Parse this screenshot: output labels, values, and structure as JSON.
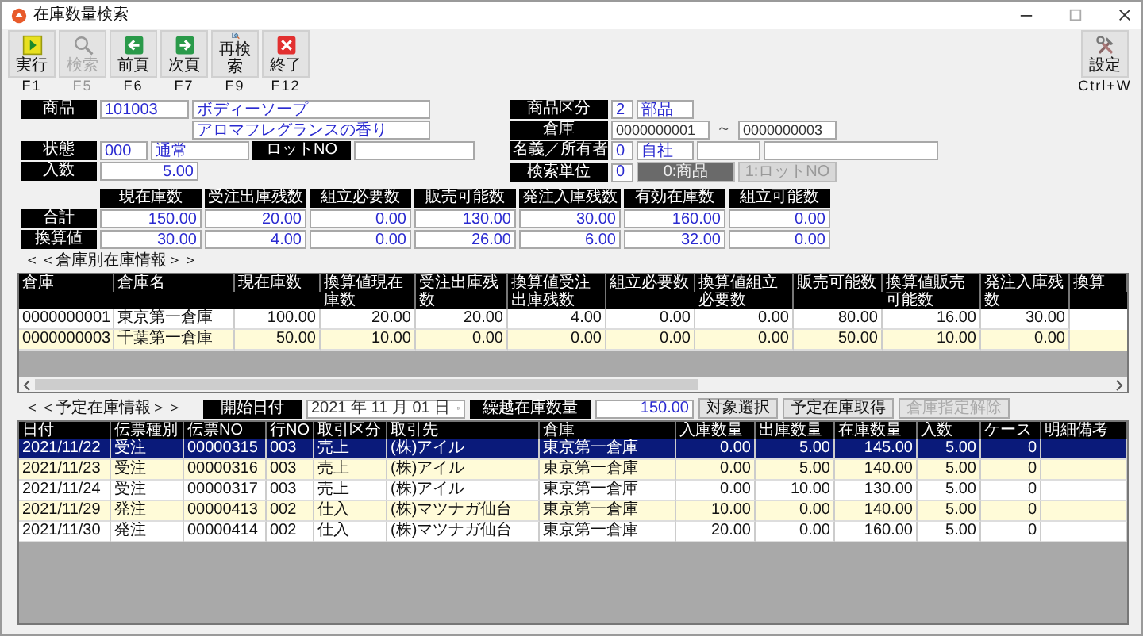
{
  "window": {
    "title": "在庫数量検索"
  },
  "toolbar": [
    {
      "kind": "run",
      "label": "実行",
      "key": "F1",
      "disabled": false
    },
    {
      "kind": "search",
      "label": "検索",
      "key": "F5",
      "disabled": true
    },
    {
      "kind": "prev",
      "label": "前頁",
      "key": "F6",
      "disabled": false
    },
    {
      "kind": "next",
      "label": "次頁",
      "key": "F7",
      "disabled": false
    },
    {
      "kind": "research",
      "label": "再検索",
      "key": "F9",
      "disabled": false
    },
    {
      "kind": "exit",
      "label": "終了",
      "key": "F12",
      "disabled": false
    }
  ],
  "settings": {
    "label": "設定",
    "key": "Ctrl+W"
  },
  "form": {
    "product": {
      "label": "商品",
      "code": "101003",
      "name": "ボディーソープ",
      "description": "アロマフレグランスの香り"
    },
    "status": {
      "label": "状態",
      "code": "000",
      "name": "通常"
    },
    "lot": {
      "label": "ロットNO"
    },
    "quantity": {
      "label": "入数",
      "value": "5.00"
    },
    "category": {
      "label": "商品区分",
      "code": "2",
      "name": "部品"
    },
    "warehouse": {
      "label": "倉庫",
      "from": "0000000001",
      "separator": "～",
      "to": "0000000003"
    },
    "owner": {
      "label": "名義／所有者",
      "code": "0",
      "name": "自社"
    },
    "search_unit": {
      "label": "検索単位",
      "code": "0",
      "options": [
        {
          "label": "0:商品",
          "selected": true
        },
        {
          "label": "1:ロットNO",
          "selected": false
        }
      ]
    }
  },
  "summary": {
    "columns": [
      "現在庫数",
      "受注出庫残数",
      "組立必要数",
      "販売可能数",
      "発注入庫残数",
      "有効在庫数",
      "組立可能数"
    ],
    "rows": [
      {
        "label": "合計",
        "values": [
          "150.00",
          "20.00",
          "0.00",
          "130.00",
          "30.00",
          "160.00",
          "0.00"
        ]
      },
      {
        "label": "換算値",
        "values": [
          "30.00",
          "4.00",
          "0.00",
          "26.00",
          "6.00",
          "32.00",
          "0.00"
        ]
      }
    ]
  },
  "warehouse_stock": {
    "title": "＜＜倉庫別在庫情報＞＞",
    "columns": [
      "倉庫",
      "倉庫名",
      "現在庫数",
      "換算値現在庫数",
      "受注出庫残数",
      "換算値受注出庫残数",
      "組立必要数",
      "換算値組立必要数",
      "販売可能数",
      "換算値販売可能数",
      "発注入庫残数",
      "換算"
    ],
    "rows": [
      {
        "cells": [
          "0000000001",
          "東京第一倉庫",
          "100.00",
          "20.00",
          "20.00",
          "4.00",
          "0.00",
          "0.00",
          "80.00",
          "16.00",
          "30.00"
        ]
      },
      {
        "cells": [
          "0000000003",
          "千葉第一倉庫",
          "50.00",
          "10.00",
          "0.00",
          "0.00",
          "0.00",
          "0.00",
          "50.00",
          "10.00",
          "0.00"
        ]
      }
    ]
  },
  "schedule": {
    "title": "＜＜予定在庫情報＞＞",
    "start_date": {
      "label": "開始日付",
      "value": "2021 年 11 月 01 日"
    },
    "carryover": {
      "label": "繰越在庫数量",
      "value": "150.00"
    },
    "buttons": [
      {
        "label": "対象選択",
        "disabled": false
      },
      {
        "label": "予定在庫取得",
        "disabled": false
      },
      {
        "label": "倉庫指定解除",
        "disabled": true
      }
    ],
    "columns": [
      "日付",
      "伝票種別",
      "伝票NO",
      "行NO",
      "取引区分",
      "取引先",
      "倉庫",
      "入庫数量",
      "出庫数量",
      "在庫数量",
      "入数",
      "ケース",
      "明細備考"
    ],
    "rows": [
      {
        "selected": true,
        "cells": [
          "2021/11/22",
          "受注",
          "00000315",
          "003",
          "売上",
          "(株)アイル",
          "東京第一倉庫",
          "0.00",
          "5.00",
          "145.00",
          "5.00",
          "0"
        ]
      },
      {
        "selected": false,
        "cells": [
          "2021/11/23",
          "受注",
          "00000316",
          "003",
          "売上",
          "(株)アイル",
          "東京第一倉庫",
          "0.00",
          "5.00",
          "140.00",
          "5.00",
          "0"
        ]
      },
      {
        "selected": false,
        "cells": [
          "2021/11/24",
          "受注",
          "00000317",
          "003",
          "売上",
          "(株)アイル",
          "東京第一倉庫",
          "0.00",
          "10.00",
          "130.00",
          "5.00",
          "0"
        ]
      },
      {
        "selected": false,
        "cells": [
          "2021/11/29",
          "発注",
          "00000413",
          "002",
          "仕入",
          "(株)マツナガ仙台",
          "東京第一倉庫",
          "10.00",
          "0.00",
          "140.00",
          "5.00",
          "0"
        ]
      },
      {
        "selected": false,
        "cells": [
          "2021/11/30",
          "発注",
          "00000414",
          "002",
          "仕入",
          "(株)マツナガ仙台",
          "東京第一倉庫",
          "20.00",
          "0.00",
          "160.00",
          "5.00",
          "0"
        ]
      }
    ]
  }
}
